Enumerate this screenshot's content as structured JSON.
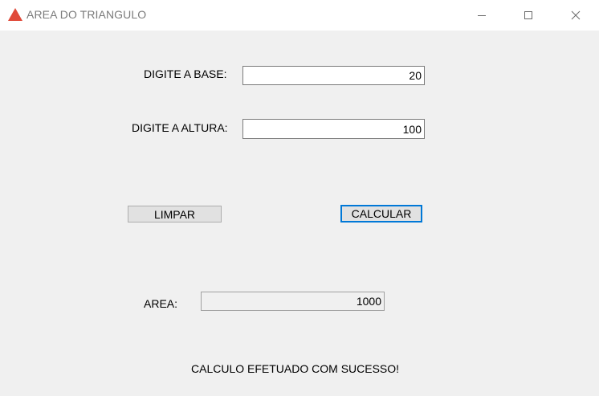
{
  "window": {
    "title": "AREA DO TRIANGULO",
    "icon": "red-triangle-icon",
    "icon_color": "#e04a3a",
    "controls": {
      "minimize_icon": "minimize-icon",
      "maximize_icon": "maximize-icon",
      "close_icon": "close-icon"
    }
  },
  "form": {
    "base_label": "DIGITE A BASE:",
    "base_value": "20",
    "height_label": "DIGITE A ALTURA:",
    "height_value": "100",
    "clear_button": "LIMPAR",
    "calculate_button": "CALCULAR",
    "area_label": "AREA:",
    "area_value": "1000",
    "status_message": "CALCULO EFETUADO COM SUCESSO!"
  },
  "colors": {
    "client_background": "#f0f0f0",
    "focus_accent": "#0078d7",
    "button_face": "#e1e1e1"
  }
}
